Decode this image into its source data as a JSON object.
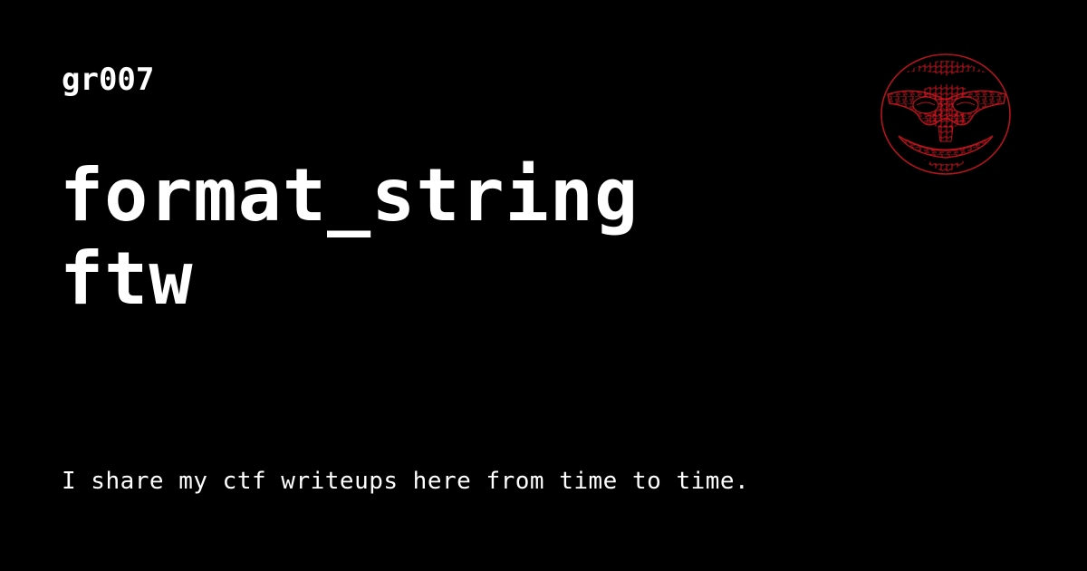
{
  "site": {
    "name": "gr007"
  },
  "post": {
    "title_lines": [
      "format_string",
      "ftw"
    ]
  },
  "description": "I share my ctf writeups here from time to time.",
  "logo": {
    "icon": "maze-smiley-logo-icon",
    "color": "#b3141c"
  },
  "colors": {
    "background": "#000000",
    "text": "#ffffff",
    "accent": "#b3141c"
  }
}
